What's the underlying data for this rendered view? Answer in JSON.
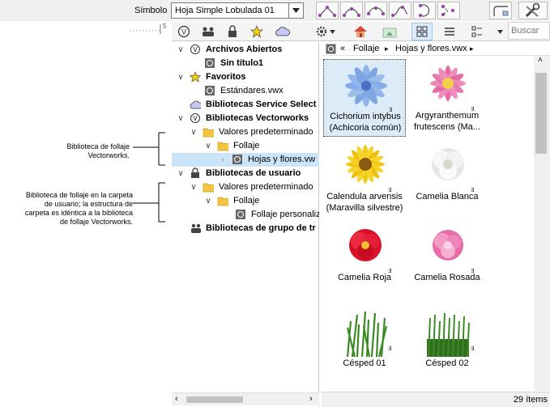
{
  "toolbar": {
    "symbol_label": "Símbolo",
    "symbol_value": "Hoja Simple Lobulada 01",
    "ruler_text": "5"
  },
  "browser": {
    "search_placeholder": "Buscar",
    "tree": [
      {
        "label": "Archivos Abiertos",
        "bold": true
      },
      {
        "label": "Sin título1",
        "bold": true
      },
      {
        "label": "Favoritos",
        "bold": true
      },
      {
        "label": "Estándares.vwx",
        "bold": false
      },
      {
        "label": "Bibliotecas Service Select",
        "bold": true
      },
      {
        "label": "Bibliotecas Vectorworks",
        "bold": true
      },
      {
        "label": "Valores predeterminado",
        "bold": false
      },
      {
        "label": "Follaje",
        "bold": false
      },
      {
        "label": "Hojas y flores.vw",
        "bold": false
      },
      {
        "label": "Bibliotecas de usuario",
        "bold": true
      },
      {
        "label": "Valores predeterminado",
        "bold": false
      },
      {
        "label": "Follaje",
        "bold": false
      },
      {
        "label": "Follaje personaliz",
        "bold": false
      },
      {
        "label": "Bibliotecas de grupo de tr",
        "bold": true
      }
    ],
    "path": {
      "back": "«",
      "folder": "Follaje",
      "sep": "▸",
      "file": "Hojas y flores.vwx",
      "end": "▸"
    },
    "items": [
      {
        "line1": "Cichorium intybus",
        "line2": "(Achicoria común)"
      },
      {
        "line1": "Argyranthemum",
        "line2": "frutescens (Ma..."
      },
      {
        "line1": "Calendula arvensis",
        "line2": "(Maravilla silvestre)"
      },
      {
        "line1": "Camelia Blanca",
        "line2": ""
      },
      {
        "line1": "Camelia Roja",
        "line2": ""
      },
      {
        "line1": "Camelia Rosada",
        "line2": ""
      },
      {
        "line1": "Césped 01",
        "line2": ""
      },
      {
        "line1": "Césped 02",
        "line2": ""
      }
    ],
    "item_count": "29 ítems"
  },
  "annotations": {
    "note1_l1": "Biblioteca de follaje",
    "note1_l2": "Vectorworks.",
    "note2_l1": "Biblioteca de follaje en la carpeta",
    "note2_l2": "de usuario; la estructura de",
    "note2_l3": "carpeta es idéntica a la biblioteca",
    "note2_l4": "de follaje Vectorworks."
  },
  "colors": {
    "selection": "#cce4f7",
    "folder": "#f5c542",
    "accent": "#9a3bb0"
  }
}
